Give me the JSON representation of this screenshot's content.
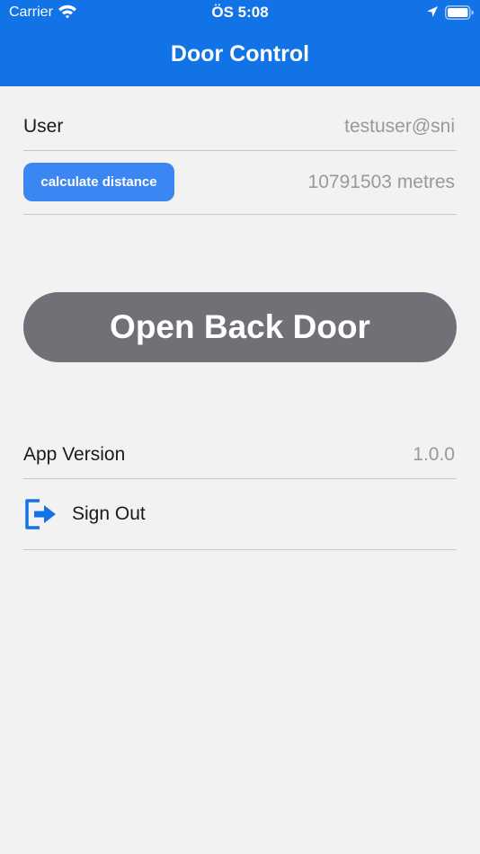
{
  "status_bar": {
    "carrier": "Carrier",
    "time": "ÖS 5:08",
    "icons": [
      "wifi-icon",
      "location-arrow-icon",
      "battery-icon"
    ]
  },
  "nav": {
    "title": "Door Control"
  },
  "settings": {
    "user_label": "User",
    "user_value": "testuser@sni",
    "calculate_button_label": "calculate distance",
    "distance_value": "10791503 metres",
    "open_door_label": "Open Back Door",
    "app_version_label": "App Version",
    "app_version_value": "1.0.0",
    "sign_out_label": "Sign Out",
    "sign_out_icon": "sign-out-icon"
  },
  "colors": {
    "header": "#1273e6",
    "accent_button": "#3c86f3",
    "door_button": "#707077",
    "background": "#f2f2f2"
  }
}
